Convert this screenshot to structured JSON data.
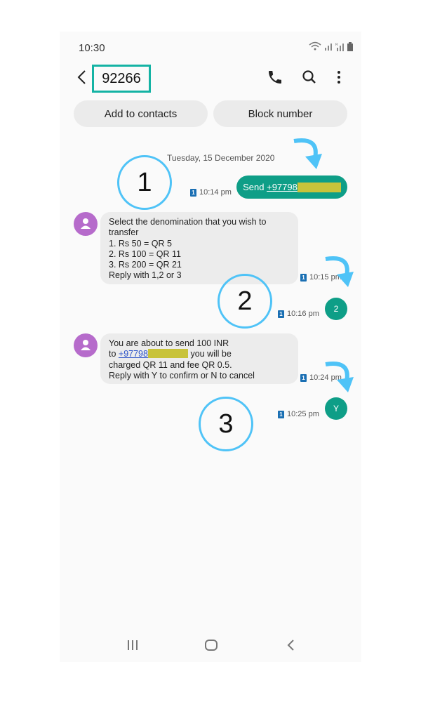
{
  "status_bar": {
    "time": "10:30",
    "icons": [
      "wifi-icon",
      "signal-icon",
      "roaming-signal-icon",
      "battery-icon"
    ]
  },
  "header": {
    "back_icon": "back-arrow-icon",
    "title": "92266",
    "actions": [
      "phone-icon",
      "search-icon",
      "more-vert-icon"
    ]
  },
  "quick_actions": {
    "add_contact": "Add to contacts",
    "block": "Block number"
  },
  "conversation": {
    "date": "Tuesday, 15 December 2020",
    "messages": [
      {
        "direction": "sent",
        "prefix": "Send ",
        "number": "+97798",
        "redacted": true,
        "time": "10:14 pm",
        "sim": "1"
      },
      {
        "direction": "received",
        "lines": [
          "Select the denomination that you wish to",
          "transfer",
          "1. Rs 50 = QR 5",
          "2. Rs 100 = QR 11",
          "3. Rs 200 = QR 21",
          "Reply with 1,2 or 3"
        ],
        "time": "10:15 pm",
        "sim": "1"
      },
      {
        "direction": "sent",
        "text": "2",
        "time": "10:16 pm",
        "sim": "1"
      },
      {
        "direction": "received",
        "line1": "You are about to send 100 INR",
        "line2_prefix": "to ",
        "line2_number": "+97798",
        "line2_suffix": " you will be",
        "line3": "charged QR 11 and fee QR 0.5.",
        "line4": "Reply with Y to confirm or N to cancel",
        "time": "10:24 pm",
        "sim": "1"
      },
      {
        "direction": "sent",
        "text": "Y",
        "time": "10:25 pm",
        "sim": "1"
      }
    ]
  },
  "annotations": {
    "step1": "1",
    "step2": "2",
    "step3": "3",
    "color": "#4fc3f7"
  },
  "colors": {
    "accent": "#0e9e87",
    "highlight_box": "#14b3a4",
    "avatar": "#b66bcb",
    "bubble": "#ececec",
    "link": "#2e55c9"
  },
  "navbar": [
    "recent-apps-icon",
    "home-icon",
    "back-icon"
  ]
}
